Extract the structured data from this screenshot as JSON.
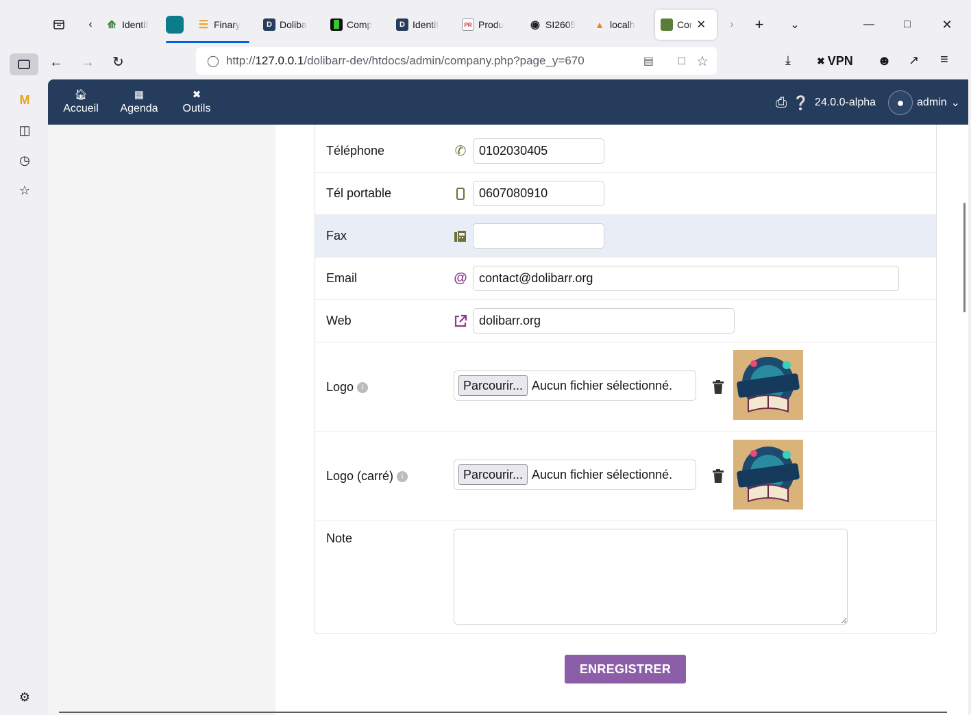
{
  "browser": {
    "tabs": [
      {
        "label": "Identif",
        "color": "#3c8c3c"
      },
      {
        "label": "",
        "color": "#0a7c8c"
      },
      {
        "label": "Finary",
        "color": "#f0a020"
      },
      {
        "label": "Doliba",
        "color": "#263c5c"
      },
      {
        "label": "Comp",
        "color": "#111111"
      },
      {
        "label": "Identif",
        "color": "#263c5c"
      },
      {
        "label": "Produ",
        "color": "#c02020"
      },
      {
        "label": "SI2605",
        "color": "#222222"
      },
      {
        "label": "localh",
        "color": "#e08a1a"
      },
      {
        "label": "Cor",
        "color": "#5a7d3a"
      }
    ],
    "url_prefix": "http://",
    "url_host": "127.0.0.1",
    "url_path": "/dolibarr-dev/htdocs/admin/company.php?page_y=670",
    "vpn_label": "VPN"
  },
  "topnav": {
    "menu": [
      {
        "label": "Accueil",
        "icon": "home-icon"
      },
      {
        "label": "Agenda",
        "icon": "calendar-icon"
      },
      {
        "label": "Outils",
        "icon": "tools-icon"
      }
    ],
    "version": "24.0.0-alpha",
    "user": "admin"
  },
  "form": {
    "phone": {
      "label": "Téléphone",
      "value": "0102030405"
    },
    "mobile": {
      "label": "Tél portable",
      "value": "0607080910"
    },
    "fax": {
      "label": "Fax",
      "value": ""
    },
    "email": {
      "label": "Email",
      "value": "contact@dolibarr.org"
    },
    "web": {
      "label": "Web",
      "value": "dolibarr.org"
    },
    "logo": {
      "label": "Logo",
      "browse": "Parcourir...",
      "nofile": "Aucun fichier sélectionné."
    },
    "logo_square": {
      "label": "Logo (carré)",
      "browse": "Parcourir...",
      "nofile": "Aucun fichier sélectionné."
    },
    "note": {
      "label": "Note",
      "value": ""
    },
    "save_label": "ENREGISTRER"
  },
  "colors": {
    "topnav_bg": "#263c5c",
    "save_button": "#8c5ea8",
    "highlight_row": "#e9edf5"
  }
}
